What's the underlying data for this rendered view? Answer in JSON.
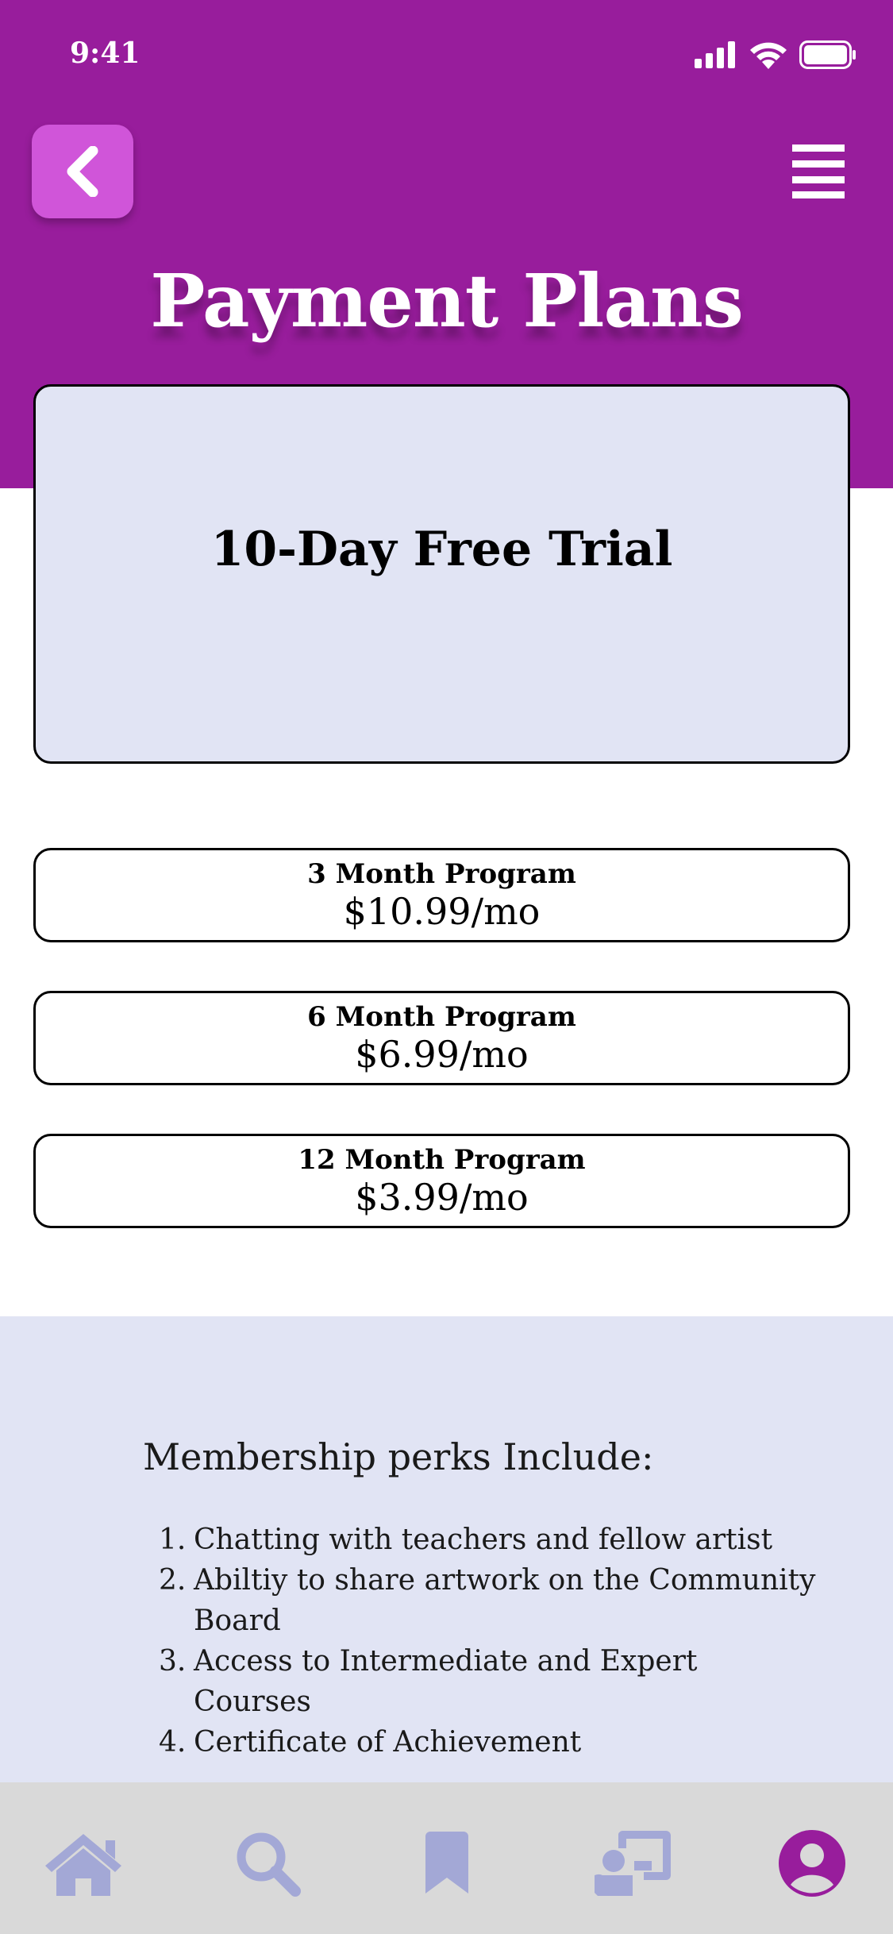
{
  "status": {
    "time": "9:41"
  },
  "header": {
    "title": "Payment Plans"
  },
  "trial": {
    "title": "10-Day Free Trial"
  },
  "plans": [
    {
      "name": "3 Month Program",
      "price": "$10.99/mo"
    },
    {
      "name": "6 Month Program",
      "price": "$6.99/mo"
    },
    {
      "name": "12 Month Program",
      "price": "$3.99/mo"
    }
  ],
  "perks": {
    "heading": "Membership perks Include:",
    "items": [
      {
        "num": "1.",
        "text": "Chatting with teachers and fellow artist"
      },
      {
        "num": "2.",
        "text": "Abiltiy to share artwork on the Community Board"
      },
      {
        "num": "3.",
        "text": "Access to Intermediate and Expert Courses"
      },
      {
        "num": "4.",
        "text": "Certificate of Achievement"
      }
    ]
  },
  "tabbar": {
    "icons": [
      "home-icon",
      "search-icon",
      "bookmark-icon",
      "teacher-icon",
      "profile-icon"
    ],
    "active": "profile-icon"
  },
  "colors": {
    "header": "#981d9c",
    "back_button": "#d055d9",
    "card": "#e1e4f4",
    "tab_icon": "#a3a8d6",
    "tab_active": "#981d9c"
  }
}
